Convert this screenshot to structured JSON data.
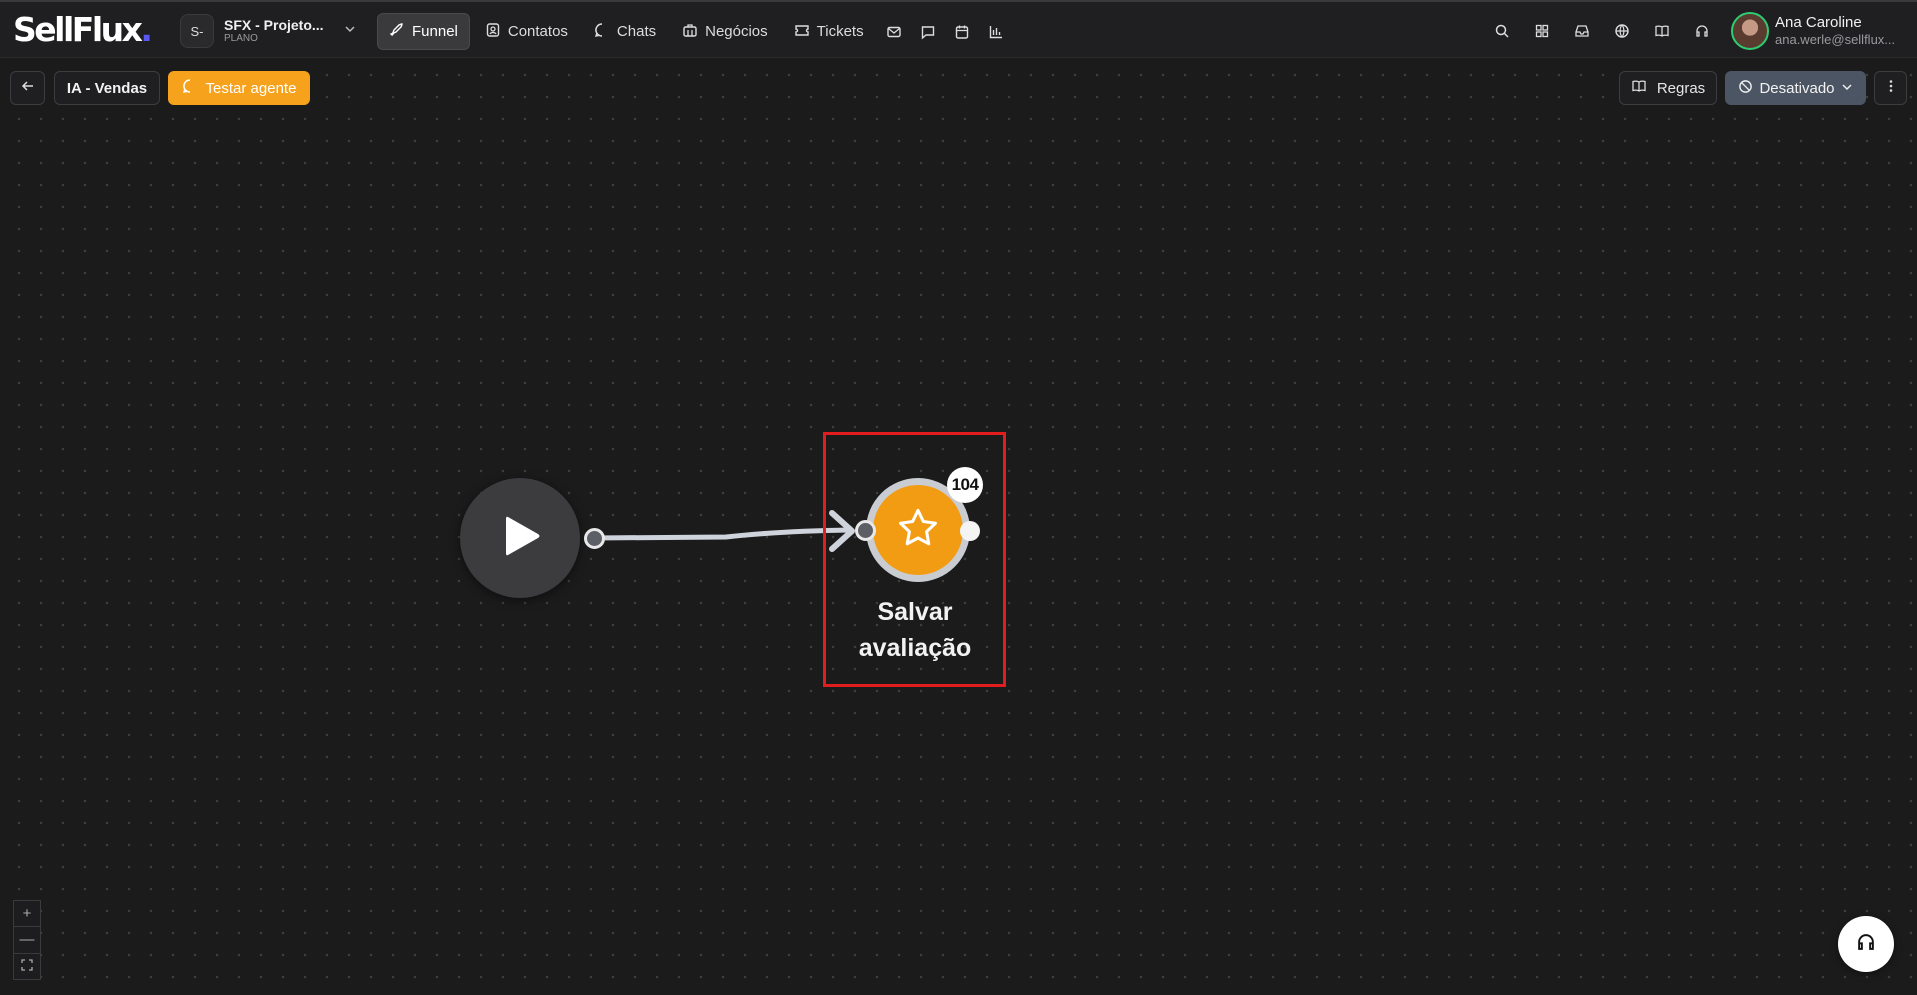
{
  "app": {
    "logo_text": "SellFlux",
    "logo_dot": "."
  },
  "project": {
    "badge": "S-",
    "name": "SFX - Projeto...",
    "plan": "PLANO"
  },
  "nav": {
    "funnel": "Funnel",
    "contatos": "Contatos",
    "chats": "Chats",
    "negocios": "Negócios",
    "tickets": "Tickets"
  },
  "user": {
    "name": "Ana Caroline",
    "email": "ana.werle@sellflux..."
  },
  "toolbar": {
    "title": "IA - Vendas",
    "test_label": "Testar agente",
    "rules_label": "Regras",
    "status_label": "Desativado"
  },
  "flow": {
    "action_node": {
      "label": "Salvar avaliação",
      "count": "104",
      "icon": "star-icon"
    },
    "start_node": {
      "icon": "play-icon"
    }
  },
  "zoom": {
    "in": "+",
    "out": "—"
  },
  "colors": {
    "accent": "#f6a21c",
    "node_orange": "#f29c14",
    "status_bg": "#4b5563",
    "selection": "#e11d1d",
    "brand_dot": "#5b57f5",
    "canvas_bg": "#1b1b1c"
  }
}
